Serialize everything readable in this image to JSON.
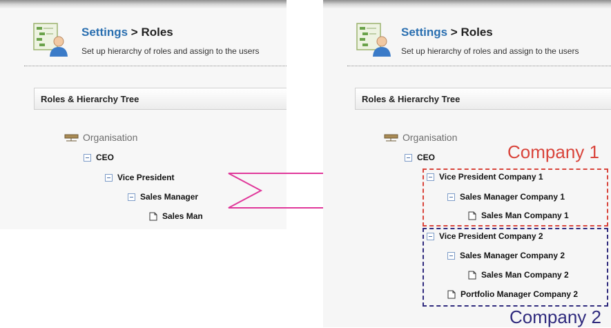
{
  "left": {
    "breadcrumb_link": "Settings",
    "breadcrumb_sep": " > ",
    "breadcrumb_current": "Roles",
    "subtitle": "Set up hierarchy of roles and assign to the users",
    "section_title": "Roles & Hierarchy Tree",
    "tree": {
      "root": "Organisation",
      "n1": "CEO",
      "n2": "Vice President",
      "n3": "Sales Manager",
      "n4": "Sales Man"
    }
  },
  "right": {
    "breadcrumb_link": "Settings",
    "breadcrumb_sep": " > ",
    "breadcrumb_current": "Roles",
    "subtitle": "Set up hierarchy of roles and assign to the users",
    "section_title": "Roles & Hierarchy Tree",
    "tree": {
      "root": "Organisation",
      "n1": "CEO",
      "c1_vp": "Vice President Company 1",
      "c1_sm": "Sales Manager Company 1",
      "c1_man": "Sales Man Company 1",
      "c2_vp": "Vice President Company 2",
      "c2_sm": "Sales Manager Company 2",
      "c2_man": "Sales Man Company 2",
      "c2_pm": "Portfolio Manager Company 2"
    }
  },
  "annotations": {
    "company1": "Company 1",
    "company2": "Company 2"
  },
  "colors": {
    "link": "#2a6fb0",
    "company1": "#d9443b",
    "company2": "#2f2a7d",
    "arrow": "#e0379a"
  },
  "icons": {
    "header": "settings-roles-icon",
    "root": "network-icon",
    "branch": "collapse-toggle-icon",
    "leaf": "document-icon"
  }
}
